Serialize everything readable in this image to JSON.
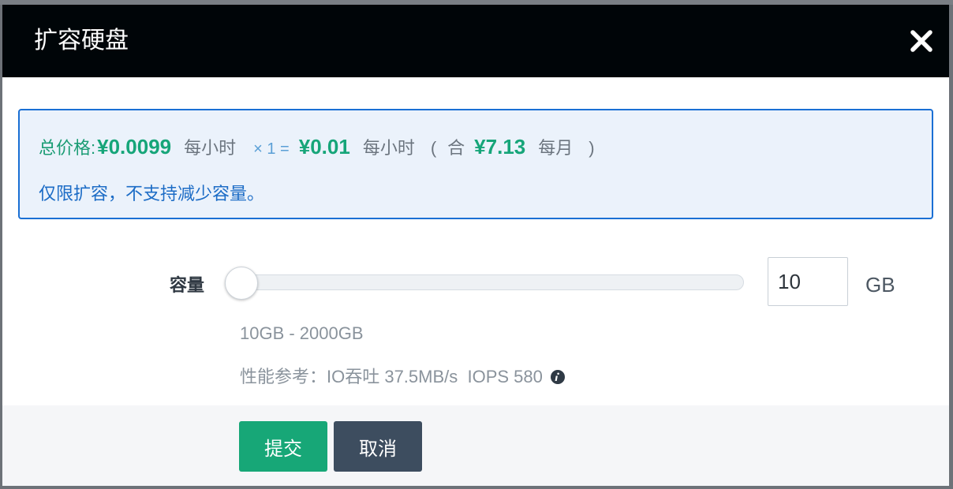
{
  "dialog": {
    "title": "扩容硬盘",
    "close_icon": "close-icon"
  },
  "pricing": {
    "total_label": "总价格:",
    "unit_price": "¥0.0099",
    "unit_price_period": "每小时",
    "multiplier": "× 1 =",
    "hourly_total": "¥0.01",
    "hourly_total_period": "每小时",
    "paren_open": "(",
    "equiv_label": "合",
    "monthly_total": "¥7.13",
    "monthly_period": "每月",
    "paren_close": ")",
    "notice": "仅限扩容，不支持减少容量。",
    "colors": {
      "border": "#1a6fd4",
      "background": "#ebf2fb",
      "price": "#16a579",
      "notice": "#1c6cc6"
    }
  },
  "capacity": {
    "label": "容量",
    "value": "10",
    "unit": "GB",
    "slider_fraction": 0,
    "range_text": "10GB - 2000GB",
    "performance_text": "性能参考：IO吞吐 37.5MB/s  IOPS 580",
    "info_icon": "info-icon"
  },
  "footer": {
    "submit_label": "提交",
    "cancel_label": "取消",
    "colors": {
      "submit": "#17a777",
      "cancel": "#3d4d5f"
    }
  }
}
